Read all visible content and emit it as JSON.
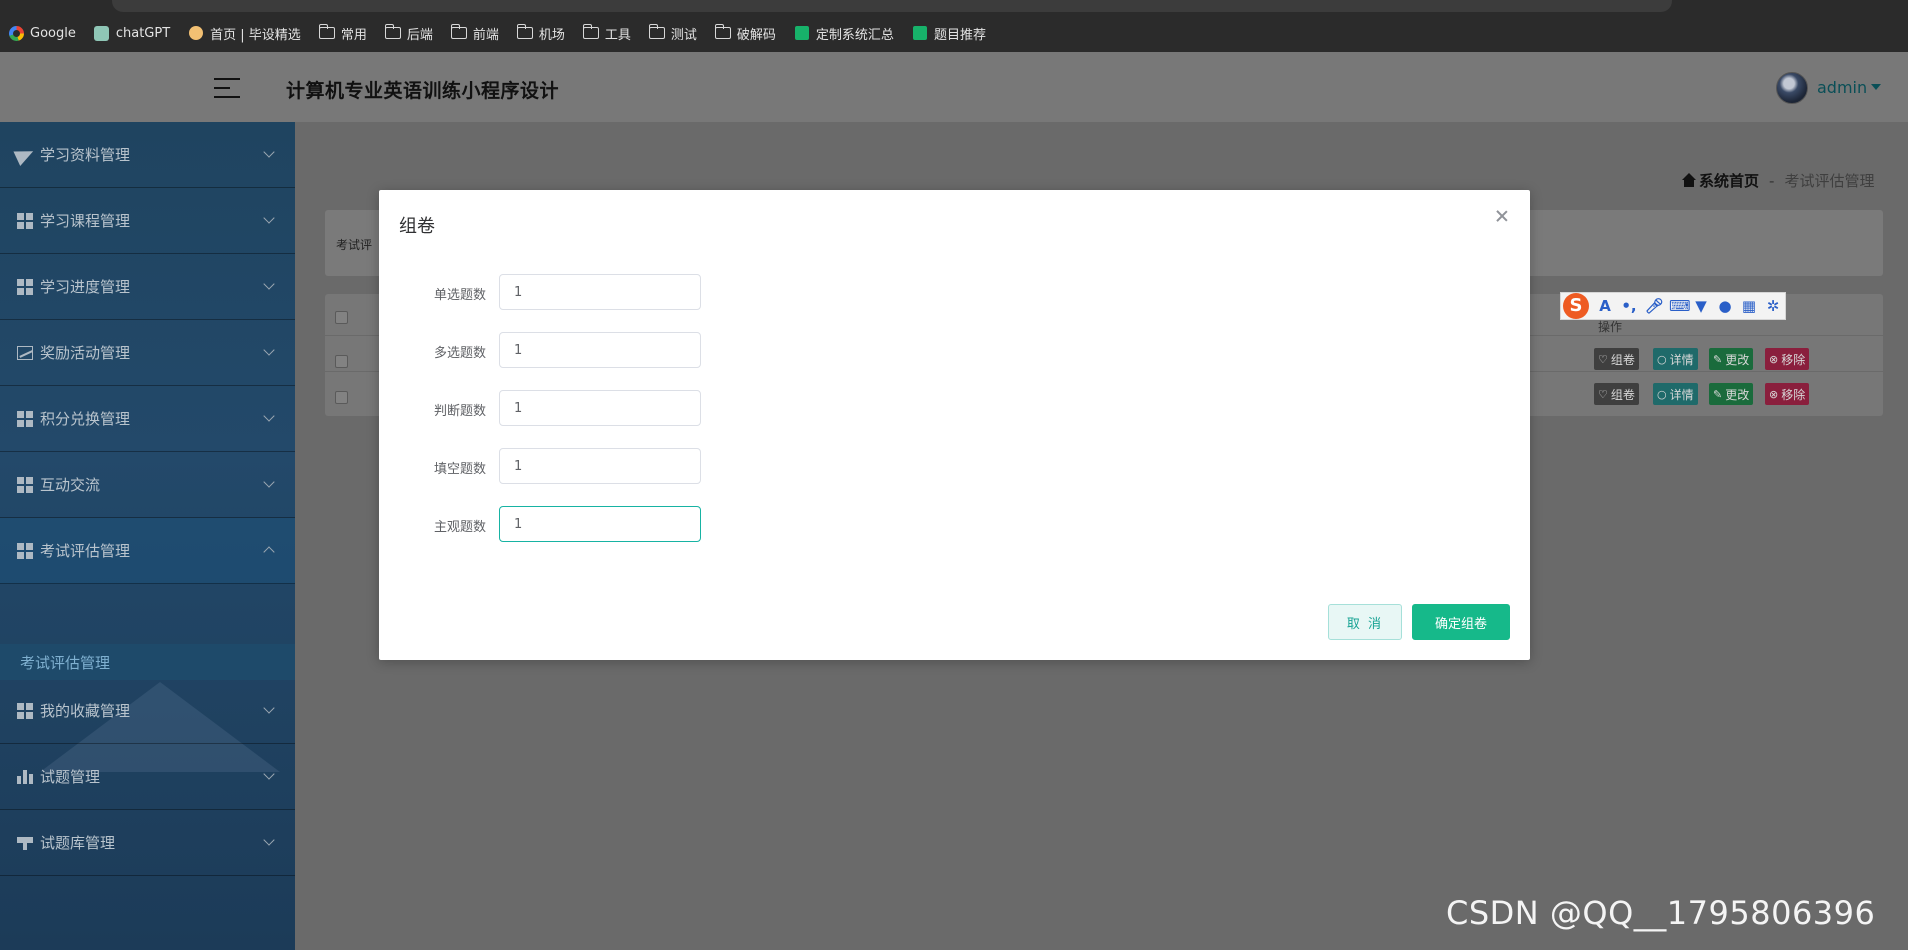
{
  "bookmarks": [
    {
      "label": "Google",
      "icon": "google-icon"
    },
    {
      "label": "chatGPT",
      "icon": "chatgpt-icon"
    },
    {
      "label": "首页 | 毕设精选",
      "icon": "home-icon"
    },
    {
      "label": "常用",
      "icon": "folder-icon"
    },
    {
      "label": "后端",
      "icon": "folder-icon"
    },
    {
      "label": "前端",
      "icon": "folder-icon"
    },
    {
      "label": "机场",
      "icon": "folder-icon"
    },
    {
      "label": "工具",
      "icon": "folder-icon"
    },
    {
      "label": "测试",
      "icon": "folder-icon"
    },
    {
      "label": "破解码",
      "icon": "folder-icon"
    },
    {
      "label": "定制系统汇总",
      "icon": "sheet-icon"
    },
    {
      "label": "题目推荐",
      "icon": "sheet-icon"
    }
  ],
  "header": {
    "title": "计算机专业英语训练小程序设计",
    "user": "admin"
  },
  "sidebar": {
    "items": [
      {
        "label": "学习资料管理",
        "icon": "paper-plane-icon"
      },
      {
        "label": "学习课程管理",
        "icon": "grid-icon"
      },
      {
        "label": "学习进度管理",
        "icon": "grid-icon"
      },
      {
        "label": "奖励活动管理",
        "icon": "line-chart-icon"
      },
      {
        "label": "积分兑换管理",
        "icon": "grid-icon"
      },
      {
        "label": "互动交流",
        "icon": "grid-icon"
      },
      {
        "label": "考试评估管理",
        "icon": "grid-icon"
      },
      {
        "label": "我的收藏管理",
        "icon": "grid-icon"
      },
      {
        "label": "试题管理",
        "icon": "bar-chart-icon"
      },
      {
        "label": "试题库管理",
        "icon": "stamp-icon"
      }
    ],
    "active_sub": "考试评估管理"
  },
  "breadcrumb": {
    "home": "系统首页",
    "separator": "-",
    "current": "考试评估管理"
  },
  "search": {
    "label_partial": "考试评"
  },
  "table": {
    "header_op": "操作",
    "row_actions": [
      {
        "label": "组卷",
        "icon": "heart-icon"
      },
      {
        "label": "详情",
        "icon": "search-icon"
      },
      {
        "label": "更改",
        "icon": "edit-icon"
      },
      {
        "label": "移除",
        "icon": "remove-icon"
      }
    ]
  },
  "modal": {
    "title": "组卷",
    "fields": [
      {
        "label": "单选题数",
        "value": "1"
      },
      {
        "label": "多选题数",
        "value": "1"
      },
      {
        "label": "判断题数",
        "value": "1"
      },
      {
        "label": "填空题数",
        "value": "1"
      },
      {
        "label": "主观题数",
        "value": "1"
      }
    ],
    "cancel_label": "取 消",
    "confirm_label": "确定组卷"
  },
  "ime": {
    "logo": "S",
    "tools": [
      "A",
      "•,",
      "mic-icon",
      "keyboard-icon",
      "shirt-icon",
      "robot-icon",
      "apps-icon",
      "settings-icon"
    ]
  },
  "watermark": "CSDN @QQ__1795806396",
  "colors": {
    "accent": "#16b98a",
    "sidebar": "#23496a",
    "remove": "#8a1f3d"
  }
}
